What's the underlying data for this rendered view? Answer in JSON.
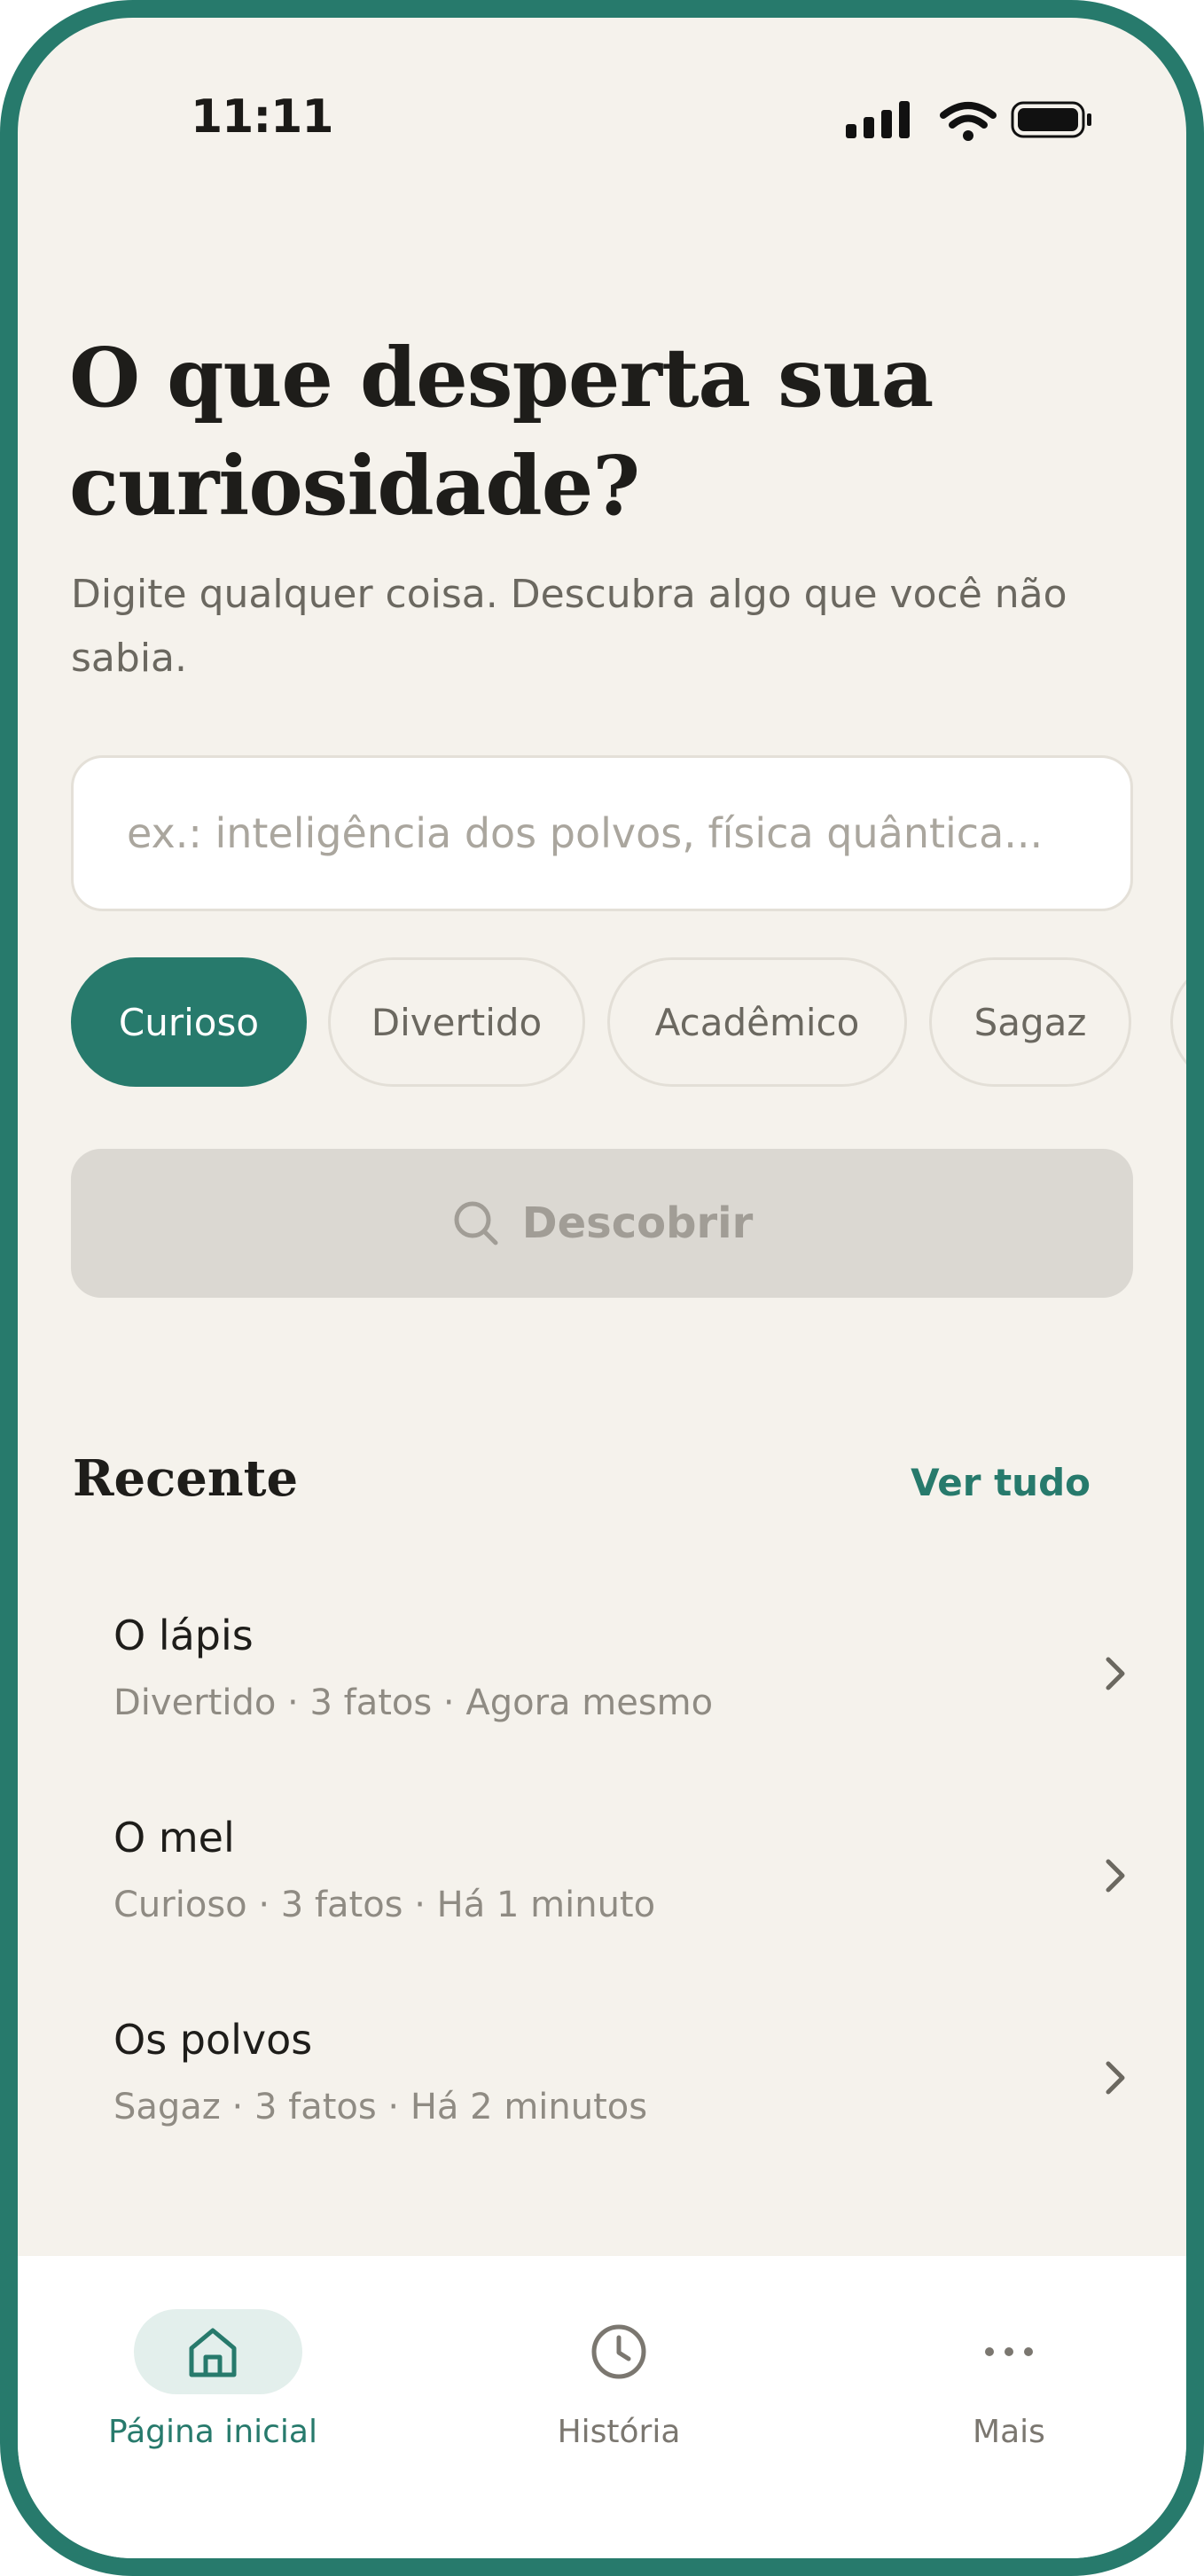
{
  "status_bar": {
    "time": "11:11"
  },
  "hero": {
    "title_line1": "O que desperta sua",
    "title_line2": "curiosidade?",
    "subtitle_line1": "Digite qualquer coisa. Descubra algo que você não",
    "subtitle_line2": "sabia."
  },
  "search": {
    "placeholder": "ex.: inteligência dos polvos, física quântica..."
  },
  "tones": {
    "items": [
      {
        "label": "Curioso",
        "selected": true
      },
      {
        "label": "Divertido",
        "selected": false
      },
      {
        "label": "Acadêmico",
        "selected": false
      },
      {
        "label": "Sagaz",
        "selected": false
      }
    ]
  },
  "discover_button": {
    "label": "Descobrir"
  },
  "recent": {
    "title": "Recente",
    "see_all": "Ver tudo",
    "items": [
      {
        "title": "O lápis",
        "meta": "Divertido · 3 fatos · Agora mesmo"
      },
      {
        "title": "O mel",
        "meta": "Curioso · 3 fatos · Há 1 minuto"
      },
      {
        "title": "Os polvos",
        "meta": "Sagaz · 3 fatos · Há 2 minutos"
      }
    ]
  },
  "tab_bar": {
    "items": [
      {
        "label": "Página inicial",
        "icon": "home-icon",
        "active": true
      },
      {
        "label": "História",
        "icon": "clock-icon",
        "active": false
      },
      {
        "label": "Mais",
        "icon": "more-icon",
        "active": false
      }
    ]
  },
  "colors": {
    "accent": "#277a6c",
    "background": "#f5f2ec",
    "text": "#1e1d1a",
    "muted": "#8f8b83"
  }
}
